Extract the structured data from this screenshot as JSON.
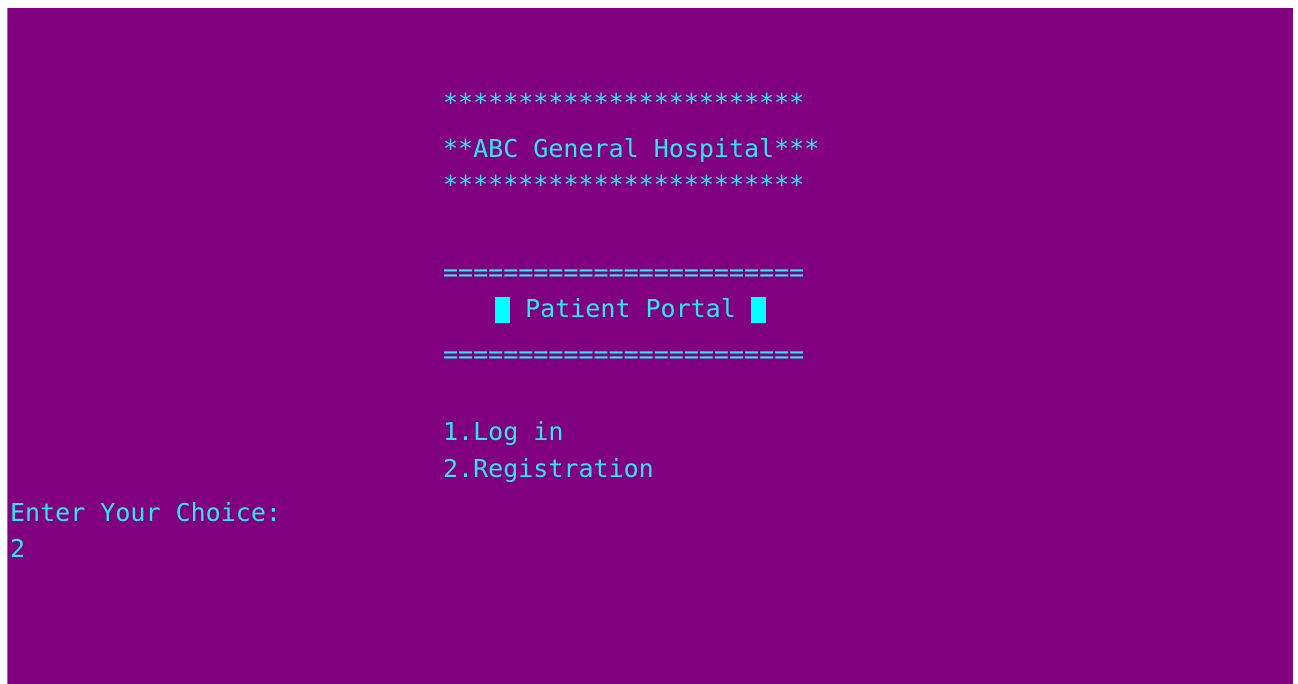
{
  "banner": {
    "stars_top": "************************",
    "hospital_name": "**ABC General Hospital***",
    "stars_bottom": "************************"
  },
  "portal": {
    "rule_top": "========================",
    "title": "Patient Portal",
    "rule_bottom": "========================"
  },
  "menu": {
    "option_1": "1.Log in",
    "option_2": "2.Registration"
  },
  "prompt": {
    "label": "Enter Your Choice:",
    "input_value": "2"
  },
  "colors": {
    "background": "#800080",
    "text": "#2ee6f0",
    "block": "#00ffff"
  }
}
